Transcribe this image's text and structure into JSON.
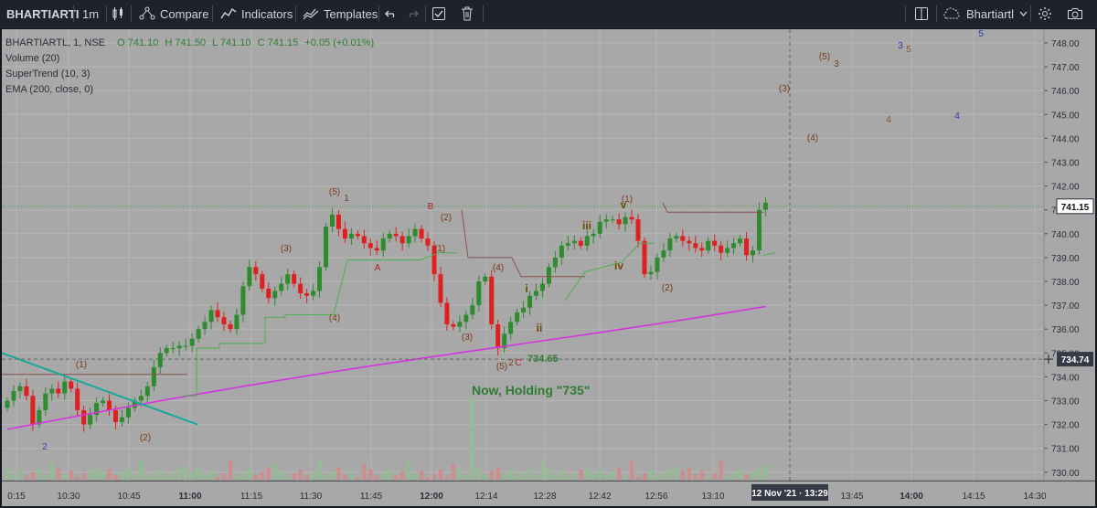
{
  "toolbar": {
    "symbol": "BHARTIARTI",
    "interval": "1m",
    "compare_label": "Compare",
    "indicators_label": "Indicators",
    "templates_label": "Templates",
    "layout_name": "Bhartiartl"
  },
  "legend": {
    "title": "BHARTIARTL, 1, NSE",
    "open": "O 741.10",
    "high": "H 741.50",
    "low": "L 741.10",
    "close": "C 741.15",
    "change": "+0.05 (+0.01%)",
    "studies": [
      "Volume (20)",
      "SuperTrend (10, 3)",
      "EMA (200, close, 0)"
    ]
  },
  "price_axis": {
    "ticks": [
      "748.00",
      "747.00",
      "746.00",
      "745.00",
      "744.00",
      "743.00",
      "742.00",
      "741.00",
      "740.00",
      "739.00",
      "738.00",
      "737.00",
      "736.00",
      "735.00",
      "734.00",
      "733.00",
      "732.00",
      "731.00",
      "730.00"
    ],
    "last_price_label": "741.15",
    "crosshair_label": "734.74"
  },
  "time_axis": {
    "ticks": [
      "0:15",
      "10:30",
      "10:45",
      "11:00",
      "11:15",
      "11:30",
      "11:45",
      "12:00",
      "12:14",
      "12:28",
      "12:42",
      "12:56",
      "13:10",
      "13:45",
      "14:00",
      "14:15",
      "14:30"
    ],
    "cursor_label": "12 Nov '21 · 13:29"
  },
  "annotations": {
    "marks": [
      "2",
      "(1)",
      "(2)",
      "(3)",
      "(4)",
      "(5)",
      "1",
      "A",
      "B",
      "(2)",
      "(1)",
      "(3)",
      "(4)",
      "(5)",
      "2",
      "C",
      "i",
      "ii",
      "iii",
      "iv",
      "v",
      "(1)",
      "(2)",
      "(3)",
      "(4)",
      "(5)",
      "3",
      "3",
      "5",
      "4",
      "4",
      "5"
    ],
    "low_price": "734.65",
    "note": "Now, Holding \"735\""
  },
  "colors": {
    "up": "#26a69a",
    "down": "#ef5350",
    "ema": "#d633e0",
    "supertrend_up": "#4caf50",
    "supertrend_down": "#8d4f4f",
    "trendline": "#1aa999",
    "last_price": "#43a047"
  },
  "chart_data": {
    "type": "candlestick",
    "symbol": "BHARTIARTL",
    "y_range": [
      729.5,
      748.5
    ],
    "candles_close": [
      733.0,
      733.4,
      733.6,
      733.2,
      732.0,
      732.6,
      733.3,
      733.5,
      733.3,
      733.8,
      733.5,
      732.6,
      732.0,
      732.4,
      732.9,
      733.0,
      732.6,
      732.1,
      732.3,
      732.7,
      733.0,
      733.2,
      733.6,
      734.4,
      735.0,
      735.2,
      735.2,
      735.3,
      735.3,
      735.6,
      736.0,
      736.3,
      736.8,
      736.5,
      736.2,
      736.0,
      736.6,
      737.8,
      738.6,
      738.3,
      737.7,
      737.3,
      737.6,
      737.9,
      738.3,
      737.9,
      737.5,
      737.4,
      737.6,
      738.6,
      740.3,
      740.8,
      740.2,
      739.8,
      740.0,
      739.9,
      739.6,
      739.4,
      739.3,
      739.8,
      740.0,
      739.9,
      739.6,
      739.9,
      740.2,
      739.8,
      739.5,
      738.3,
      737.1,
      736.2,
      736.1,
      736.3,
      736.6,
      737.0,
      738.0,
      738.2,
      736.2,
      735.2,
      735.8,
      736.3,
      736.7,
      736.9,
      737.4,
      737.6,
      737.9,
      738.6,
      739.0,
      739.5,
      739.6,
      739.7,
      739.5,
      739.9,
      740.0,
      740.5,
      740.6,
      740.6,
      740.4,
      740.7,
      740.6,
      739.7,
      738.3,
      738.4,
      739.0,
      739.3,
      739.8,
      739.9,
      739.7,
      739.6,
      739.4,
      739.3,
      739.7,
      739.5,
      739.2,
      739.4,
      739.6,
      739.8,
      739.1,
      739.3,
      741.0,
      741.3
    ],
    "low_marked": 734.65
  }
}
